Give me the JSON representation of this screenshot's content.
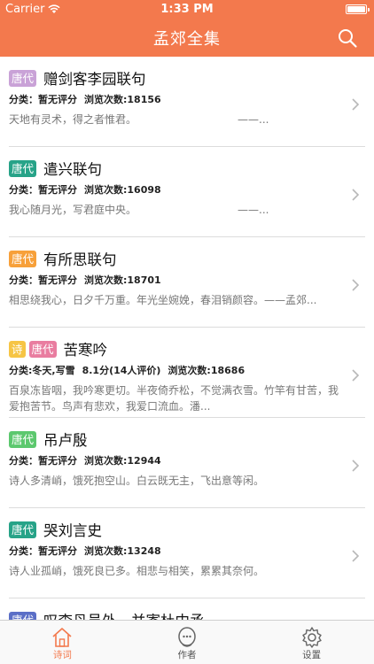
{
  "status": {
    "carrier": "Carrier",
    "time": "1:33 PM"
  },
  "nav": {
    "title": "孟郊全集"
  },
  "colors": {
    "accent": "#f3794d",
    "tang_purple": "#c9a2d7",
    "tang_teal": "#27a388",
    "tang_orange": "#f7a03a",
    "tang_pink": "#e97da0",
    "shi_yellow": "#f6c545",
    "tang_green": "#5cc86e",
    "tang_blue": "#5b6fc7"
  },
  "list": [
    {
      "tags": [
        "唐代"
      ],
      "tag_colors": [
        "#c9a2d7"
      ],
      "title": "赠剑客李园联句",
      "category": "分类：暂无评分",
      "rating": "",
      "views": "浏览次数:18156",
      "excerpt": "天地有灵术，得之者惟君。　　　　　　　　　　——..."
    },
    {
      "tags": [
        "唐代"
      ],
      "tag_colors": [
        "#27a388"
      ],
      "title": "遣兴联句",
      "category": "分类：暂无评分",
      "rating": "",
      "views": "浏览次数:16098",
      "excerpt": "我心随月光，写君庭中央。　　　　　　　　　　——..."
    },
    {
      "tags": [
        "唐代"
      ],
      "tag_colors": [
        "#f7a03a"
      ],
      "title": "有所思联句",
      "category": "分类：暂无评分",
      "rating": "",
      "views": "浏览次数:18701",
      "excerpt": "相思绕我心，日夕千万重。年光坐婉娩，春泪销颜容。——孟郊..."
    },
    {
      "tags": [
        "诗",
        "唐代"
      ],
      "tag_colors": [
        "#f6c545",
        "#e97da0"
      ],
      "title": "苦寒吟",
      "category": "分类:冬天,写雪",
      "rating": "8.1分(14人评价)",
      "views": "浏览次数:18686",
      "excerpt": "百泉冻皆咽，我吟寒更切。半夜倚乔松，不觉满衣雪。竹竿有甘苦，我爱抱苦节。鸟声有悲欢，我爱口流血。潘..."
    },
    {
      "tags": [
        "唐代"
      ],
      "tag_colors": [
        "#5cc86e"
      ],
      "title": "吊卢殷",
      "category": "分类：暂无评分",
      "rating": "",
      "views": "浏览次数:12944",
      "excerpt": "诗人多清峭，饿死抱空山。白云既无主，飞出意等闲。"
    },
    {
      "tags": [
        "唐代"
      ],
      "tag_colors": [
        "#27a388"
      ],
      "title": "哭刘言史",
      "category": "分类：暂无评分",
      "rating": "",
      "views": "浏览次数:13248",
      "excerpt": "诗人业孤峭，饿死良已多。相悲与相笑，累累其奈何。"
    },
    {
      "tags": [
        "唐代"
      ],
      "tag_colors": [
        "#5b6fc7"
      ],
      "title": "叹李丹员外，并寄杜中丞",
      "category": "",
      "rating": "",
      "views": "",
      "excerpt": ""
    }
  ],
  "tabs": [
    {
      "label": "诗词",
      "icon": "home-icon",
      "active": true
    },
    {
      "label": "作者",
      "icon": "author-icon",
      "active": false
    },
    {
      "label": "设置",
      "icon": "gear-icon",
      "active": false
    }
  ]
}
